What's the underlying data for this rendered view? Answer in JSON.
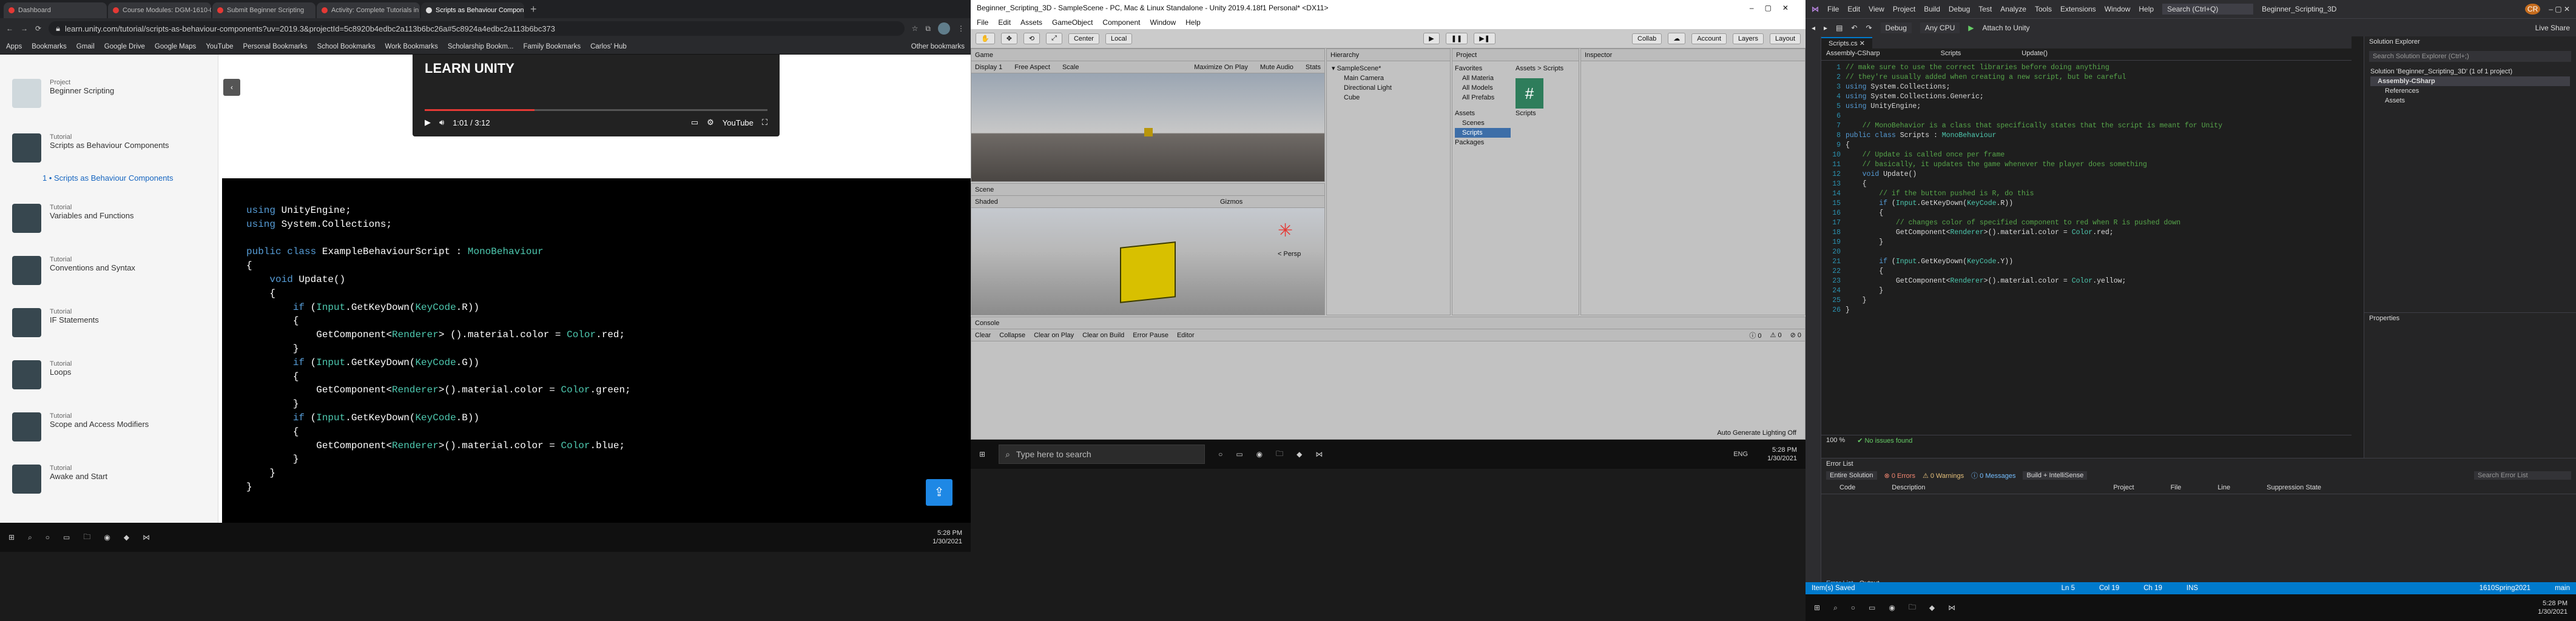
{
  "browser": {
    "tabs": [
      "Dashboard",
      "Course Modules: DGM-1610-01",
      "Submit Beginner Scripting",
      "Activity: Complete Tutorials in S",
      "Scripts as Behaviour Componen"
    ],
    "url": "learn.unity.com/tutorial/scripts-as-behaviour-components?uv=2019.3&projectId=5c8920b4edbc2a113b6bc26a#5c8924a4edbc2a113b6bc373",
    "bookmarks": [
      "Apps",
      "Bookmarks",
      "Gmail",
      "Google Drive",
      "Google Maps",
      "YouTube",
      "Personal Bookmarks",
      "School Bookmarks",
      "Work Bookmarks",
      "Scholarship Bookm...",
      "Family Bookmarks",
      "Carlos' Hub",
      "Other bookmarks"
    ]
  },
  "learn": {
    "project_label": "Project",
    "project_name": "Beginner Scripting",
    "items": [
      {
        "kind": "Tutorial",
        "title": "Scripts as Behaviour Components"
      },
      {
        "kind": "",
        "title": "1 • Scripts as Behaviour Components"
      },
      {
        "kind": "Tutorial",
        "title": "Variables and Functions"
      },
      {
        "kind": "Tutorial",
        "title": "Conventions and Syntax"
      },
      {
        "kind": "Tutorial",
        "title": "IF Statements"
      },
      {
        "kind": "Tutorial",
        "title": "Loops"
      },
      {
        "kind": "Tutorial",
        "title": "Scope and Access Modifiers"
      },
      {
        "kind": "Tutorial",
        "title": "Awake and Start"
      }
    ],
    "video": {
      "brand": "LEARN UNITY",
      "time": "1:01 / 3:12",
      "platform": "YouTube",
      "progress": 0.32
    },
    "code": "using UnityEngine;\nusing System.Collections;\n\npublic class ExampleBehaviourScript : MonoBehaviour\n{\n    void Update()\n    {\n        if (Input.GetKeyDown(KeyCode.R))\n        {\n            GetComponent<Renderer> ().material.color = Color.red;\n        }\n        if (Input.GetKeyDown(KeyCode.G))\n        {\n            GetComponent<Renderer>().material.color = Color.green;\n        }\n        if (Input.GetKeyDown(KeyCode.B))\n        {\n            GetComponent<Renderer>().material.color = Color.blue;\n        }\n    }\n}"
  },
  "taskbar1": {
    "time": "5:28 PM",
    "date": "1/30/2021"
  },
  "unity": {
    "title": "Beginner_Scripting_3D - SampleScene - PC, Mac & Linux Standalone - Unity 2019.4.18f1 Personal* <DX11>",
    "menu": [
      "File",
      "Edit",
      "Assets",
      "GameObject",
      "Component",
      "Window",
      "Help"
    ],
    "toolbar": {
      "center": "Center",
      "local": "Local",
      "account": "Account",
      "layers": "Layers",
      "layout": "Layout",
      "collab": "Collab"
    },
    "game": {
      "tab": "Game",
      "display": "Display 1",
      "aspect": "Free Aspect",
      "scale": "Scale",
      "maximize": "Maximize On Play",
      "mute": "Mute Audio",
      "stats": "Stats"
    },
    "scene": {
      "tab": "Scene",
      "shaded": "Shaded",
      "gizmos": "Gizmos",
      "persp": "< Persp"
    },
    "hierarchy": {
      "tab": "Hierarchy",
      "scene": "SampleScene*",
      "items": [
        "Main Camera",
        "Directional Light",
        "Cube"
      ]
    },
    "project": {
      "tab": "Project",
      "favorites": "Favorites",
      "fav_items": [
        "All Materia",
        "All Models",
        "All Prefabs"
      ],
      "assets": "Assets",
      "asset_items": [
        "Scenes",
        "Scripts",
        "Packages"
      ],
      "breadcrumb": "Assets > Scripts",
      "file": "Scripts"
    },
    "inspector": {
      "tab": "Inspector"
    },
    "console": {
      "tab": "Console",
      "buttons": [
        "Clear",
        "Collapse",
        "Clear on Play",
        "Clear on Build",
        "Error Pause",
        "Editor"
      ],
      "counts": [
        "0",
        "0",
        "0"
      ]
    },
    "status": "Auto Generate Lighting Off"
  },
  "taskbar2": {
    "search_placeholder": "Type here to search",
    "lang": "ENG",
    "time": "5:28 PM",
    "date": "1/30/2021"
  },
  "vs": {
    "menu": [
      "File",
      "Edit",
      "View",
      "Project",
      "Build",
      "Debug",
      "Test",
      "Analyze",
      "Tools",
      "Extensions",
      "Window",
      "Help"
    ],
    "search": "Search (Ctrl+Q)",
    "solution_title": "Beginner_Scripting_3D",
    "user": "CR",
    "live_share": "Live Share",
    "toolbar": {
      "config": "Debug",
      "platform": "Any CPU",
      "attach": "Attach to Unity"
    },
    "file_tab": "Scripts.cs",
    "nav": [
      "Assembly-CSharp",
      "Scripts",
      "Update()"
    ],
    "code": "// make sure to use the correct libraries before doing anything\n// they're usually added when creating a new script, but be careful\nusing System.Collections;\nusing System.Collections.Generic;\nusing UnityEngine;\n\n    // MonoBehavior is a class that specifically states that the script is meant for Unity\npublic class Scripts : MonoBehaviour\n{\n    // Update is called once per frame\n    // basically, it updates the game whenever the player does something\n    void Update()\n    {\n        // if the button pushed is R, do this\n        if (Input.GetKeyDown(KeyCode.R))\n        {\n            // changes color of specified component to red when R is pushed down\n            GetComponent<Renderer>().material.color = Color.red;\n        }\n\n        if (Input.GetKeyDown(KeyCode.Y))\n        {\n            GetComponent<Renderer>().material.color = Color.yellow;\n        }\n    }\n}",
    "editor_footer": {
      "zoom": "100 %",
      "issues": "No issues found"
    },
    "solution_explorer": {
      "title": "Solution Explorer",
      "search": "Search Solution Explorer (Ctrl+;)",
      "solution": "Solution 'Beginner_Scripting_3D' (1 of 1 project)",
      "project": "Assembly-CSharp",
      "items": [
        "References",
        "Assets"
      ]
    },
    "properties": {
      "title": "Properties"
    },
    "errors": {
      "title": "Error List",
      "scope": "Entire Solution",
      "errors": "0 Errors",
      "warnings": "0 Warnings",
      "messages": "0 Messages",
      "build": "Build + IntelliSense",
      "search": "Search Error List",
      "cols": [
        "Code",
        "Description",
        "Project",
        "File",
        "Line",
        "Suppression State"
      ],
      "tabs": [
        "Error List",
        "Output"
      ]
    },
    "status": {
      "saved": "Item(s) Saved",
      "ln": "Ln 5",
      "col": "Col 19",
      "ch": "Ch 19",
      "ins": "INS",
      "branch": "main",
      "repo": "1610Spring2021"
    },
    "taskbar": {
      "time": "5:28 PM",
      "date": "1/30/2021"
    }
  }
}
